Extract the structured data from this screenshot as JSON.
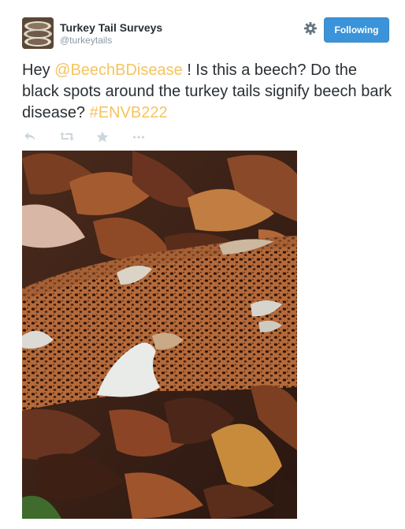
{
  "account": {
    "name": "Turkey Tail Surveys",
    "handle": "@turkeytails",
    "avatar_icon": "turkey-tail-fungus-avatar"
  },
  "header": {
    "settings_icon": "gear-icon",
    "follow_label": "Following"
  },
  "tweet": {
    "prefix": "Hey",
    "mention": "@BeechBDisease",
    "body": "! Is this a beech? Do the black spots around the turkey tails signify beech bark disease?",
    "hashtag": "#ENVB222"
  },
  "actions": [
    {
      "icon": "reply-icon"
    },
    {
      "icon": "retweet-icon"
    },
    {
      "icon": "favorite-star-icon"
    },
    {
      "icon": "more-icon"
    }
  ],
  "colors": {
    "accent": "#f5c45f",
    "button": "#3b94d9",
    "text": "#292f33",
    "muted": "#8899a6"
  }
}
